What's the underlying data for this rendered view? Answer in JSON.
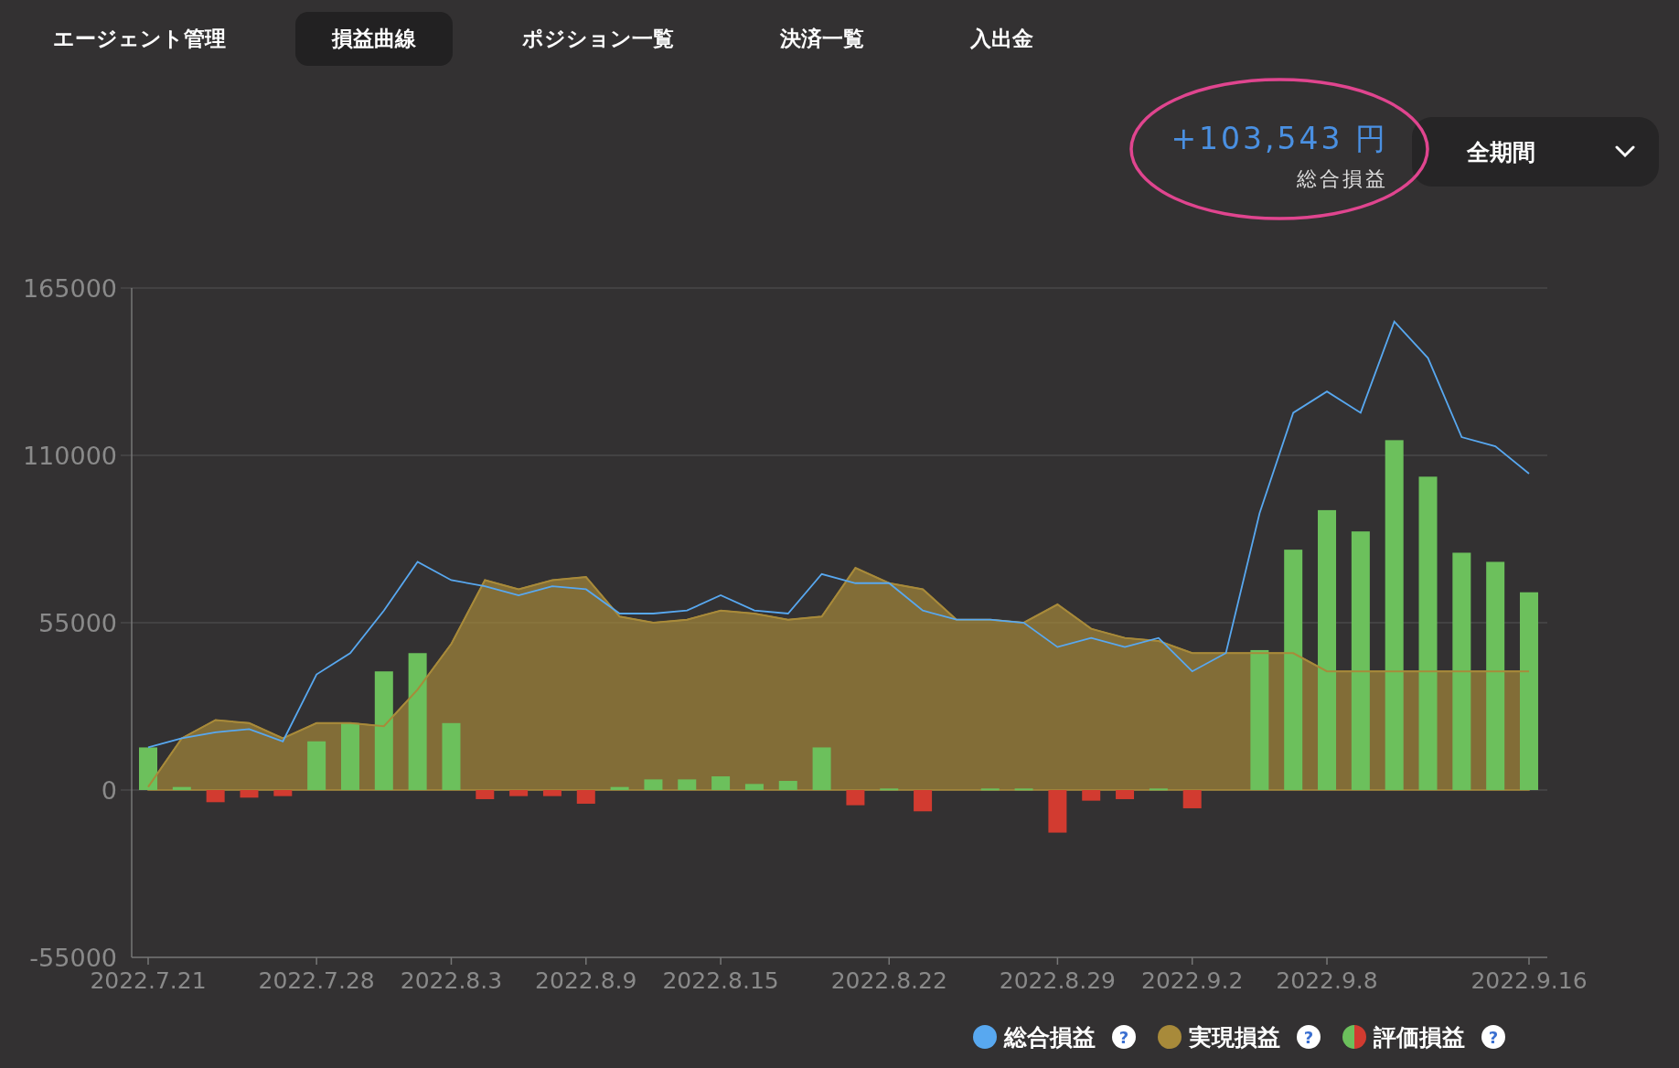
{
  "tabs": [
    {
      "label": "エージェント管理",
      "selected": false
    },
    {
      "label": "損益曲線",
      "selected": true
    },
    {
      "label": "ポジション一覧",
      "selected": false
    },
    {
      "label": "決済一覧",
      "selected": false
    },
    {
      "label": "入出金",
      "selected": false
    }
  ],
  "summary": {
    "amount": "+103,543 円",
    "label": "総合損益",
    "highlighted": true
  },
  "period_select": {
    "value": "全期間"
  },
  "chart_data": {
    "type": "line",
    "grid": true,
    "ylim": [
      -55000,
      165000
    ],
    "yticks": [
      -55000,
      0,
      55000,
      110000,
      165000
    ],
    "categories": [
      "2022.7.21",
      null,
      null,
      null,
      null,
      "2022.7.28",
      null,
      null,
      null,
      "2022.8.3",
      null,
      null,
      null,
      "2022.8.9",
      null,
      null,
      null,
      "2022.8.15",
      null,
      null,
      null,
      null,
      "2022.8.22",
      null,
      null,
      null,
      null,
      "2022.8.29",
      null,
      null,
      null,
      "2022.9.2",
      null,
      null,
      null,
      "2022.9.8",
      null,
      null,
      null,
      null,
      null,
      "2022.9.16"
    ],
    "series": [
      {
        "name": "総合損益",
        "type": "line",
        "color": "#58a8f0",
        "values": [
          14000,
          17000,
          19000,
          20000,
          16000,
          38000,
          45000,
          59000,
          75000,
          69000,
          67000,
          64000,
          67000,
          66000,
          58000,
          58000,
          59000,
          64000,
          59000,
          58000,
          71000,
          68000,
          68000,
          59000,
          56000,
          56000,
          55000,
          47000,
          50000,
          47000,
          50000,
          39000,
          45000,
          91000,
          124000,
          131000,
          124000,
          154000,
          142000,
          116000,
          113000,
          104000
        ]
      },
      {
        "name": "実現損益",
        "type": "area",
        "color": "#a88a3a",
        "values": [
          1000,
          17000,
          23000,
          22000,
          17000,
          22000,
          22000,
          21000,
          33000,
          48000,
          69000,
          66000,
          69000,
          70000,
          57000,
          55000,
          56000,
          59000,
          58000,
          56000,
          57000,
          73000,
          68000,
          66000,
          56000,
          56000,
          55000,
          61000,
          53000,
          50000,
          49000,
          45000,
          45000,
          45000,
          45000,
          39000,
          39000,
          39000,
          39000,
          39000,
          39000,
          39000
        ]
      },
      {
        "name": "評価損益",
        "type": "bar",
        "color": "#6cc05c",
        "values": [
          14000,
          1000,
          null,
          null,
          null,
          16000,
          22000,
          39000,
          45000,
          22000,
          null,
          null,
          null,
          null,
          1000,
          3500,
          3500,
          4500,
          2000,
          3000,
          14000,
          null,
          500,
          null,
          0,
          500,
          500,
          null,
          null,
          null,
          500,
          null,
          0,
          46000,
          79000,
          92000,
          85000,
          115000,
          103000,
          78000,
          75000,
          65000
        ]
      },
      {
        "type": "bar",
        "color": "#d23b30",
        "values": [
          null,
          null,
          -4000,
          -2500,
          -2000,
          null,
          null,
          null,
          null,
          null,
          -3000,
          -2000,
          -2000,
          -4500,
          null,
          null,
          null,
          null,
          null,
          null,
          null,
          -5000,
          null,
          -7000,
          null,
          null,
          null,
          -14000,
          -3500,
          -3000,
          null,
          -6000,
          null,
          null,
          null,
          null,
          null,
          null,
          null,
          null,
          null,
          null
        ]
      }
    ]
  },
  "legend": [
    {
      "kind": "solid",
      "help": "?"
    },
    {
      "kind": "solid",
      "help": "?"
    },
    {
      "kind": "split",
      "help": "?"
    }
  ]
}
